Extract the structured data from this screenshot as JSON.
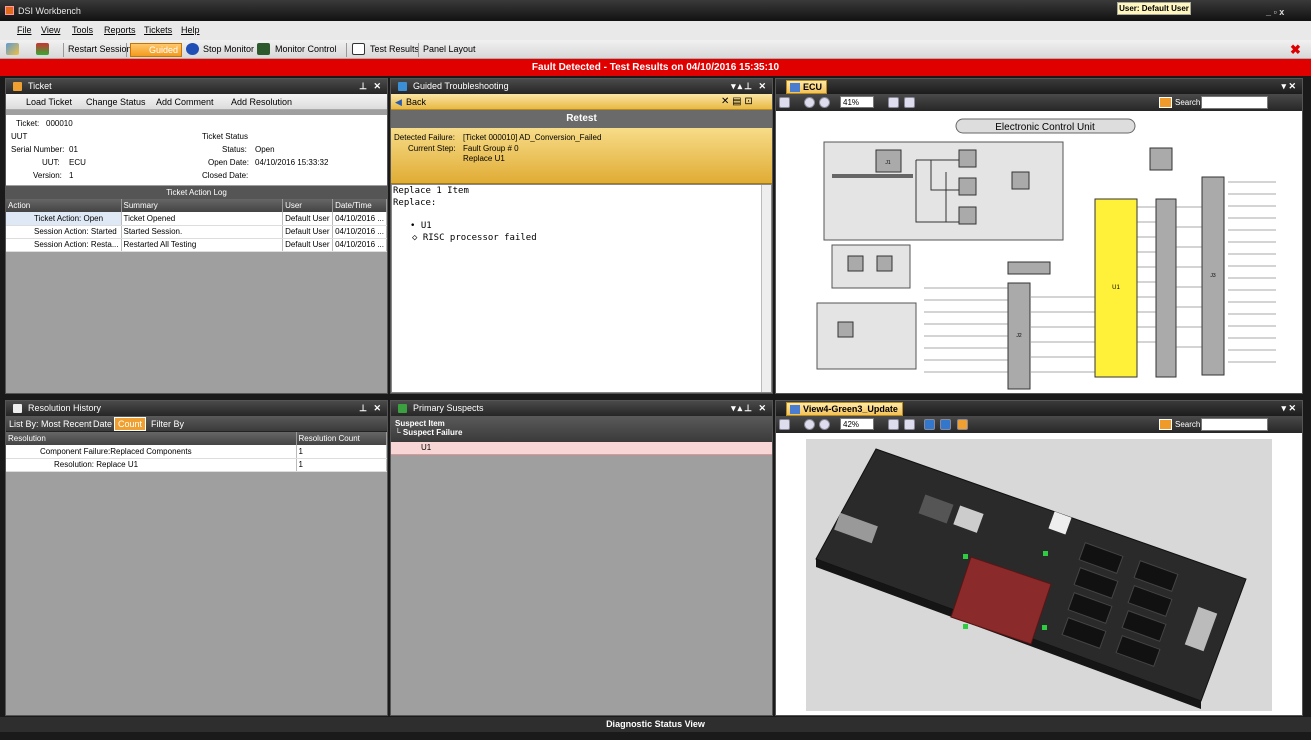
{
  "app": {
    "title": "DSI Workbench",
    "user_badge": "User: Default User",
    "controls": "_ ▫ x"
  },
  "menu": {
    "items": [
      "File",
      "View",
      "Tools",
      "Reports",
      "Tickets",
      "Help"
    ]
  },
  "toolbar": {
    "restart": "Restart Session",
    "guided": "Guided",
    "stop": "Stop Monitor",
    "monitor": "Monitor Control",
    "test_results": "Test Results",
    "panel_layout": "Panel Layout"
  },
  "fault_banner": "Fault Detected - Test Results on 04/10/2016 15:35:10",
  "ticket": {
    "title": "Ticket",
    "actions": {
      "load": "Load Ticket",
      "status": "Change Status",
      "comment": "Add Comment",
      "resolution": "Add Resolution"
    },
    "ticket_label": "Ticket:",
    "ticket_no": "000010",
    "uut_heading": "UUT",
    "serial_label": "Serial Number:",
    "serial": "01",
    "uut_label": "UUT:",
    "uut": "ECU",
    "version_label": "Version:",
    "version": "1",
    "status_heading": "Ticket Status",
    "status_label": "Status:",
    "status": "Open",
    "open_label": "Open Date:",
    "open_date": "04/10/2016 15:33:32",
    "closed_label": "Closed Date:",
    "log_title": "Ticket Action Log",
    "log_columns": [
      "Action",
      "Summary",
      "User",
      "Date/Time"
    ],
    "log_rows": [
      {
        "action": "Ticket Action: Open",
        "summary": "Ticket Opened",
        "user": "Default User",
        "date": "04/10/2016 ..."
      },
      {
        "action": "Session Action: Started",
        "summary": "Started Session.",
        "user": "Default User",
        "date": "04/10/2016 ..."
      },
      {
        "action": "Session Action: Resta...",
        "summary": "Restarted All Testing",
        "user": "Default User",
        "date": "04/10/2016 ..."
      }
    ]
  },
  "guided": {
    "title": "Guided Troubleshooting",
    "back": "Back",
    "retest": "Retest",
    "detected_label": "Detected Failure:",
    "detected": "[Ticket 000010] AD_Conversion_Failed",
    "step_label": "Current Step:",
    "step1": "Fault Group # 0",
    "step2": "Replace U1",
    "content": {
      "line1": "Replace 1 Item",
      "line2": "Replace:",
      "item": "• U1",
      "detail": "◇ RISC processor failed"
    }
  },
  "ecu": {
    "tab": "ECU",
    "zoom": "41%",
    "search": "Search",
    "board_title": "Electronic Control Unit",
    "u1": "U1",
    "j1": "J1",
    "j2": "J2",
    "j3": "J3"
  },
  "resolution": {
    "title": "Resolution History",
    "list_by": "List By:",
    "most_recent": "Most Recent",
    "date": "Date",
    "count": "Count",
    "filter": "Filter By",
    "columns": [
      "Resolution",
      "Resolution Count"
    ],
    "rows": [
      {
        "name": "Component Failure:Replaced Components",
        "count": "1"
      },
      {
        "name": "Resolution: Replace U1",
        "count": "1"
      }
    ]
  },
  "suspects": {
    "title": "Primary Suspects",
    "col1": "Suspect Item",
    "col2": "└ Suspect Failure",
    "item": "U1"
  },
  "view4": {
    "tab": "View4-Green3_Update",
    "zoom": "42%",
    "search": "Search"
  },
  "status_view": "Diagnostic Status View"
}
